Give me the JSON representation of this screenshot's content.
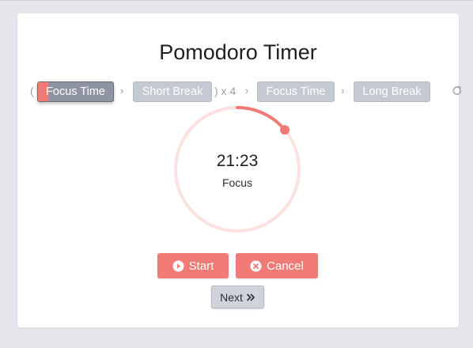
{
  "app": {
    "title": "Pomodoro Timer"
  },
  "sequence": {
    "open_paren": "(",
    "close_mult": ") x 4",
    "phases": [
      {
        "label": "Focus Time",
        "active": true,
        "progress": 0.14
      },
      {
        "label": "Short Break",
        "active": false
      },
      {
        "label": "Focus Time",
        "active": false
      },
      {
        "label": "Long Break",
        "active": false
      }
    ],
    "chevron_icon": "chevron-right-icon",
    "reset_icon": "refresh-icon"
  },
  "timer": {
    "time": "21:23",
    "mode": "Focus",
    "progress": 0.14,
    "ring_color": "#f07a75",
    "track_color": "#fbe1df"
  },
  "controls": {
    "start_label": "Start",
    "cancel_label": "Cancel",
    "next_label": "Next",
    "start_icon": "play-circle-icon",
    "cancel_icon": "x-circle-icon",
    "next_icon": "double-chevron-right-icon"
  },
  "colors": {
    "accent": "#f07a75",
    "inactive_phase": "#c5c9d1",
    "active_phase": "#8e94a1"
  }
}
